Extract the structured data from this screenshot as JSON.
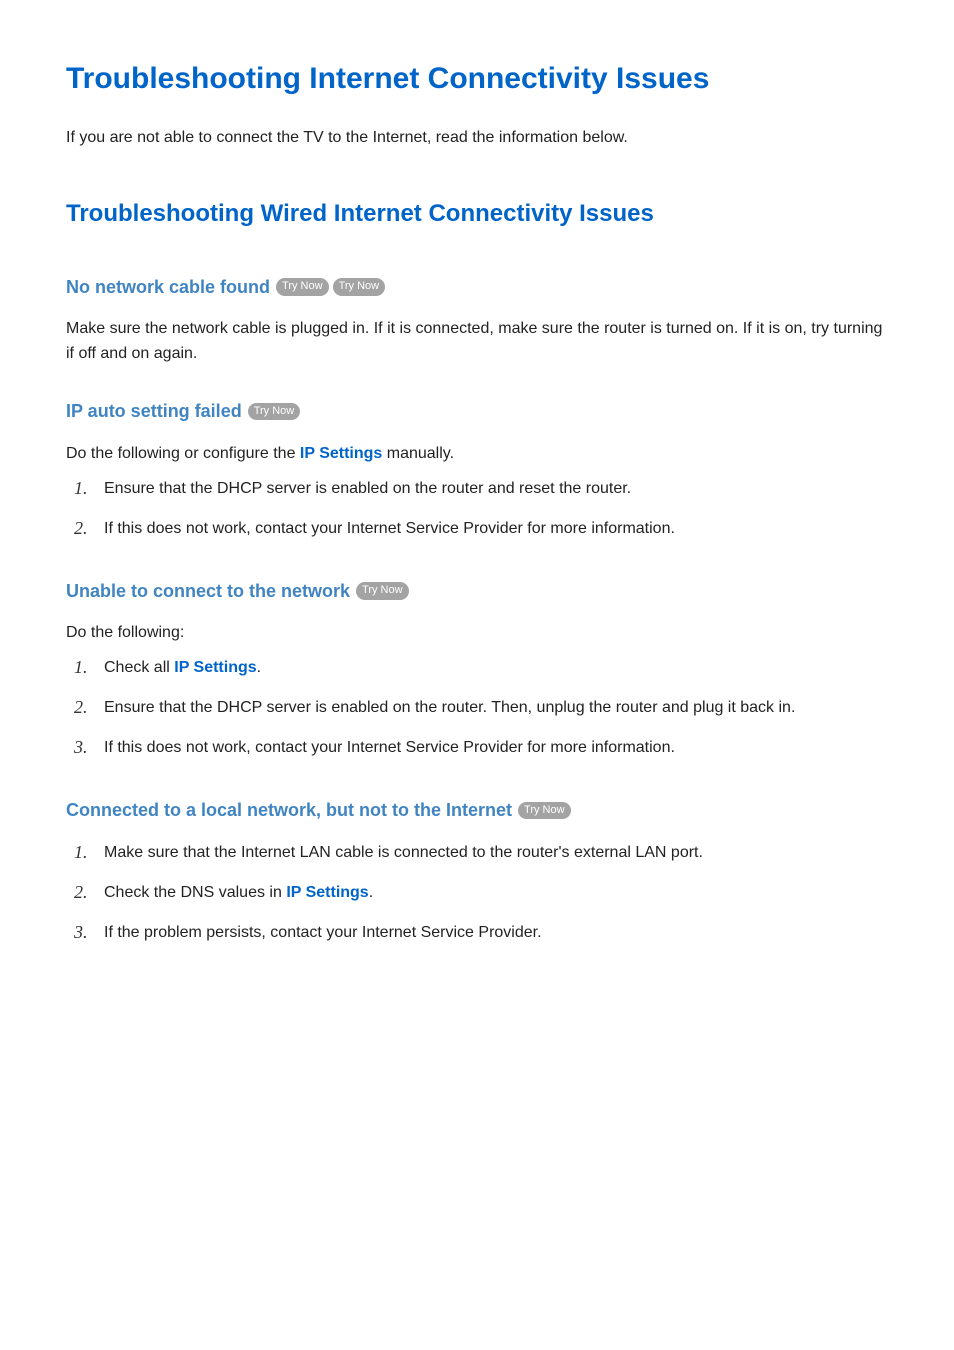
{
  "page": {
    "title": "Troubleshooting Internet Connectivity Issues",
    "intro": "If you are not able to connect the TV to the Internet, read the information below."
  },
  "section": {
    "title": "Troubleshooting Wired Internet Connectivity Issues"
  },
  "try_now_label": "Try Now",
  "ip_settings_label": "IP Settings",
  "sub1": {
    "title": "No network cable found",
    "body": "Make sure the network cable is plugged in. If it is connected, make sure the router is turned on. If it is on, try turning if off and on again."
  },
  "sub2": {
    "title": "IP auto setting failed",
    "lead_pre": "Do the following or configure the ",
    "lead_post": " manually.",
    "steps": [
      "Ensure that the DHCP server is enabled on the router and reset the router.",
      "If this does not work, contact your Internet Service Provider for more information."
    ]
  },
  "sub3": {
    "title": "Unable to connect to the network",
    "lead": "Do the following:",
    "step1_pre": "Check all ",
    "step1_post": ".",
    "steps_rest": [
      "Ensure that the DHCP server is enabled on the router. Then, unplug the router and plug it back in.",
      "If this does not work, contact your Internet Service Provider for more information."
    ]
  },
  "sub4": {
    "title": "Connected to a local network, but not to the Internet",
    "step1": "Make sure that the Internet LAN cable is connected to the router's external LAN port.",
    "step2_pre": "Check the DNS values in ",
    "step2_post": ".",
    "step3": "If the problem persists, contact your Internet Service Provider."
  }
}
